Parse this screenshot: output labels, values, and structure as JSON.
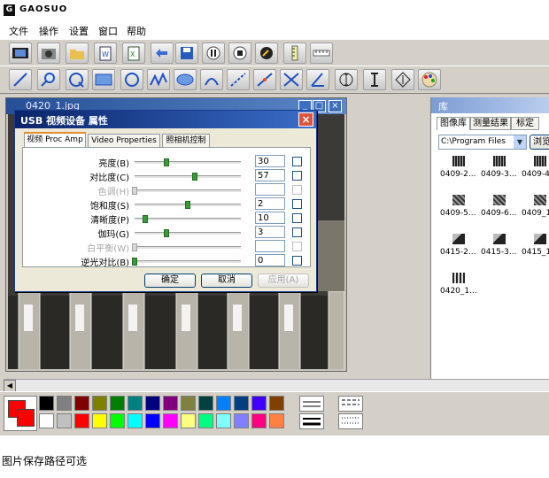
{
  "window": {
    "title": "GAOSUO"
  },
  "menu": [
    "文件",
    "操作",
    "设置",
    "窗口",
    "帮助"
  ],
  "toolbar1": [
    "film-icon",
    "camera-icon",
    "open-folder-icon",
    "word-doc-icon",
    "excel-doc-icon",
    "settings-icon",
    "save-icon",
    "pause-icon",
    "stop-icon",
    "tools-icon",
    "ruler-vertical-icon",
    "ruler-horizontal-icon"
  ],
  "toolbar2": [
    "line-icon",
    "zoom-icon",
    "circle-magnifier-icon",
    "rectangle-icon",
    "circle-icon",
    "polyline-icon",
    "ellipse-icon",
    "arc-icon",
    "dashed-line-icon",
    "point-line-icon",
    "angle-icon",
    "angle-measure-icon",
    "vertical-gauge-icon",
    "width-gauge-icon",
    "diamond-gauge-icon",
    "palette-icon"
  ],
  "image_window": {
    "title": "0420_1.jpg"
  },
  "dialog": {
    "title": "USB 视频设备 属性",
    "tabs": [
      "视频 Proc Amp",
      "Video Properties",
      "照相机控制"
    ],
    "properties": [
      {
        "label": "亮度(B)",
        "value": "30",
        "pos": 0.3,
        "enabled": true
      },
      {
        "label": "对比度(C)",
        "value": "57",
        "pos": 0.57,
        "enabled": true
      },
      {
        "label": "色调(H)",
        "value": "",
        "pos": 0.0,
        "enabled": false
      },
      {
        "label": "饱和度(S)",
        "value": "2",
        "pos": 0.5,
        "enabled": true
      },
      {
        "label": "清晰度(P)",
        "value": "10",
        "pos": 0.1,
        "enabled": true
      },
      {
        "label": "伽玛(G)",
        "value": "3",
        "pos": 0.3,
        "enabled": true
      },
      {
        "label": "白平衡(W)",
        "value": "",
        "pos": 0.0,
        "enabled": false
      },
      {
        "label": "逆光对比(B)",
        "value": "0",
        "pos": 0.0,
        "enabled": true
      }
    ],
    "buttons": {
      "ok": "确定",
      "cancel": "取消",
      "apply": "应用(A)"
    }
  },
  "library": {
    "title": "库",
    "tabs": [
      "图像库",
      "测量结果",
      "标定"
    ],
    "path": "C:\\Program Files",
    "browse": "浏览",
    "thumbnails": [
      "0409-2...",
      "0409-3...",
      "0409-4",
      "0409-5...",
      "0409-6...",
      "0409_1",
      "0415-2...",
      "0415-3...",
      "0415_1",
      "0420_1..."
    ]
  },
  "palette": {
    "row1": [
      "#000000",
      "#808080",
      "#800000",
      "#808000",
      "#008000",
      "#008080",
      "#000080",
      "#800080",
      "#808040",
      "#004040",
      "#0080ff",
      "#004080",
      "#4000ff",
      "#804000"
    ],
    "row2": [
      "#ffffff",
      "#c0c0c0",
      "#ff0000",
      "#ffff00",
      "#00ff00",
      "#00ffff",
      "#0000ff",
      "#ff00ff",
      "#ffff80",
      "#00ff80",
      "#80ffff",
      "#8080ff",
      "#ff0080",
      "#ff8040"
    ],
    "current": [
      "#ff0000",
      "#ff0000"
    ]
  },
  "caption": "图片保存路径可选"
}
